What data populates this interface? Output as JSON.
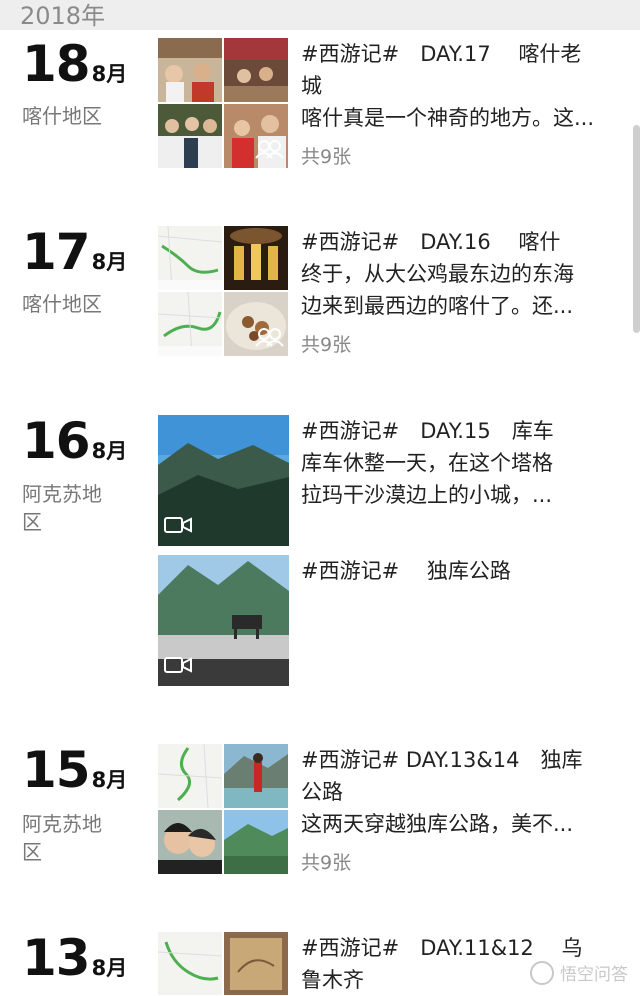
{
  "year_label": "2018年",
  "entries": [
    {
      "day": "18",
      "month": "8月",
      "location": "喀什地区",
      "lines": [
        "#西游记#　DAY.17　 喀什老",
        "城",
        "喀什真是一个神奇的地方。这..."
      ],
      "count": "共9张"
    },
    {
      "day": "17",
      "month": "8月",
      "location": "喀什地区",
      "lines": [
        "#西游记#　DAY.16　 喀什",
        "终于，从大公鸡最东边的东海",
        "边来到最西边的喀什了。还..."
      ],
      "count": "共9张"
    },
    {
      "day": "16",
      "month": "8月",
      "location_lines": [
        "阿克苏地",
        "区"
      ],
      "lines": [
        "#西游记#　DAY.15　库车",
        "库车休整一天，在这个塔格",
        "拉玛干沙漠边上的小城，..."
      ],
      "lines2": [
        "#西游记#　 独库公路"
      ]
    },
    {
      "day": "15",
      "month": "8月",
      "location_lines": [
        "阿克苏地",
        "区"
      ],
      "lines": [
        "#西游记# DAY.13&14　独库",
        "公路",
        "这两天穿越独库公路，美不..."
      ],
      "count": "共9张"
    },
    {
      "day": "13",
      "month": "8月",
      "lines": [
        "#西游记#　DAY.11&12　 乌",
        "鲁木齐"
      ]
    }
  ],
  "watermark": "悟空问答",
  "colors": {
    "year_bar": "#eeeeee",
    "muted": "#8a8a8a",
    "text": "#222222"
  }
}
